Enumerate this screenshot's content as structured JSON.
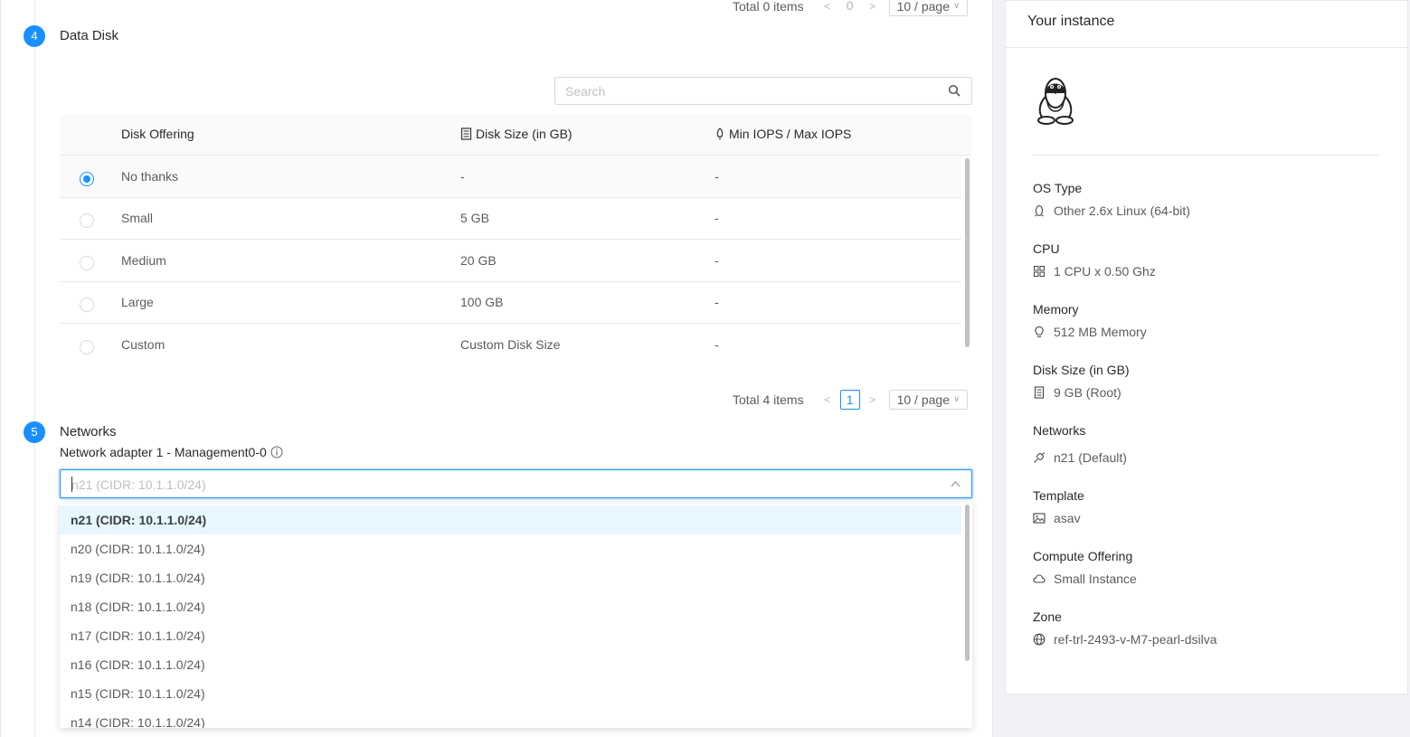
{
  "top_pager": {
    "total": "Total 0 items",
    "page": "0",
    "size": "10 / page"
  },
  "data_disk": {
    "step": "4",
    "title": "Data Disk",
    "search_placeholder": "Search",
    "columns": [
      "Disk Offering",
      "Disk Size (in GB)",
      "Min IOPS / Max IOPS"
    ],
    "rows": [
      {
        "name": "No thanks",
        "size": "-",
        "iops": "-",
        "selected": true
      },
      {
        "name": "Small",
        "size": "5 GB",
        "iops": "-",
        "selected": false
      },
      {
        "name": "Medium",
        "size": "20 GB",
        "iops": "-",
        "selected": false
      },
      {
        "name": "Large",
        "size": "100 GB",
        "iops": "-",
        "selected": false
      },
      {
        "name": "Custom",
        "size": "Custom Disk Size",
        "iops": "-",
        "selected": false
      }
    ],
    "pager": {
      "total": "Total 4 items",
      "page": "1",
      "size": "10 / page"
    }
  },
  "networks": {
    "step": "5",
    "title": "Networks",
    "adapter_label": "Network adapter 1 - Management0-0",
    "select_placeholder": "n21 (CIDR: 10.1.1.0/24)",
    "options": [
      "n21 (CIDR: 10.1.1.0/24)",
      "n20 (CIDR: 10.1.1.0/24)",
      "n19 (CIDR: 10.1.1.0/24)",
      "n18 (CIDR: 10.1.1.0/24)",
      "n17 (CIDR: 10.1.1.0/24)",
      "n16 (CIDR: 10.1.1.0/24)",
      "n15 (CIDR: 10.1.1.0/24)",
      "n14 (CIDR: 10.1.1.0/24)"
    ],
    "active_option": 0
  },
  "instance": {
    "title": "Your instance",
    "avatar_icon": "linux-penguin-icon",
    "fields": [
      {
        "label": "OS Type",
        "value": "Other 2.6x Linux (64-bit)",
        "icon": "linux-icon"
      },
      {
        "label": "CPU",
        "value": "1 CPU x 0.50 Ghz",
        "icon": "cpu-icon"
      },
      {
        "label": "Memory",
        "value": "512 MB Memory",
        "icon": "bulb-icon"
      },
      {
        "label": "Disk Size (in GB)",
        "value": "9 GB (Root)",
        "icon": "disk-icon"
      },
      {
        "label": "Networks",
        "value": "n21 (Default)",
        "icon": "api-icon"
      },
      {
        "label": "Template",
        "value": "asav",
        "icon": "picture-icon"
      },
      {
        "label": "Compute Offering",
        "value": "Small Instance",
        "icon": "cloud-icon"
      },
      {
        "label": "Zone",
        "value": "ref-trl-2493-v-M7-pearl-dsilva",
        "icon": "global-icon"
      }
    ]
  },
  "colors": {
    "primary": "#1890ff",
    "active_option_bg": "#e6f7ff",
    "border": "#e8e8e8"
  }
}
